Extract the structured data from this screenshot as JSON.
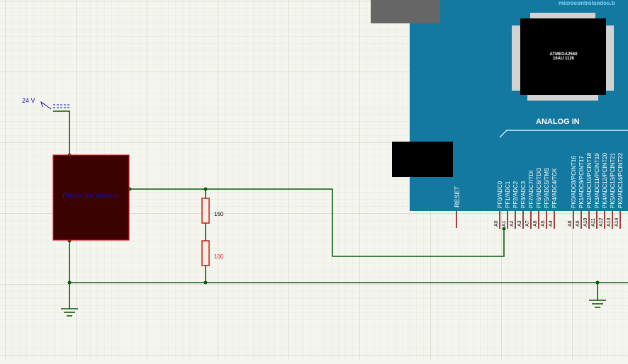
{
  "supply": {
    "label": "24 V"
  },
  "sensor": {
    "label": "Pressure sensor"
  },
  "resistors": [
    {
      "value": "150"
    },
    {
      "value": "100"
    }
  ],
  "board": {
    "watermark": "microcontrolandos.b",
    "chip_name": "ATMEGA2560",
    "chip_code": "16AU 1126",
    "analog_header": "ANALOG IN",
    "reset_label": "RESET",
    "pins": [
      {
        "name": "PF0/ADC0",
        "num": "A0"
      },
      {
        "name": "PF1/ADC1",
        "num": "A1"
      },
      {
        "name": "PF2/ADC2",
        "num": "A2"
      },
      {
        "name": "PF3/ADC3",
        "num": "A3"
      },
      {
        "name": "PF7/ADC7/TDI",
        "num": "A7"
      },
      {
        "name": "PF6/ADC6/TDO",
        "num": "A6"
      },
      {
        "name": "PF5/ADC5/TMS",
        "num": "A5"
      },
      {
        "name": "PF4/ADC4/TCK",
        "num": "A4"
      },
      {
        "name": "PK0/ADC8/PCINT16",
        "num": "A8"
      },
      {
        "name": "PK1/ADC9/PCINT17",
        "num": "A9"
      },
      {
        "name": "PK2/ADC10/PCINT18",
        "num": "A10"
      },
      {
        "name": "PK3/ADC11/PCINT19",
        "num": "A11"
      },
      {
        "name": "PK4/ADC12/PCINT20",
        "num": "A12"
      },
      {
        "name": "PK5/ADC13/PCINT21",
        "num": "A13"
      },
      {
        "name": "PK6/ADC14/PCINT22",
        "num": "A14"
      }
    ]
  },
  "colors": {
    "wire": "#0b5a0b",
    "board": "#1479a0",
    "sensor_fill": "#3a0202",
    "sensor_border": "#d81818",
    "resistor_border": "#c01010",
    "pin": "#8a1010",
    "label_blue": "#1010b0"
  }
}
